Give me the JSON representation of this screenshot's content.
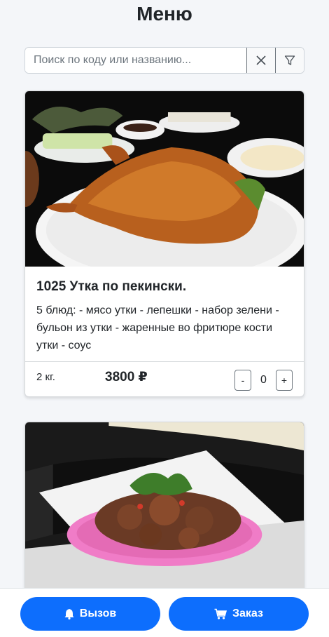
{
  "header": {
    "title": "Меню"
  },
  "search": {
    "placeholder": "Поиск по коду или названию...",
    "value": "",
    "clear_icon": "close-icon",
    "filter_icon": "filter-icon"
  },
  "items": [
    {
      "title": "1025 Утка по пекински.",
      "description": "5 блюд: - мясо утки - лепешки - набор зелени - бульон из утки - жаренные во фритюре кости утки - соус",
      "weight": "2 кг.",
      "price": "3800 ₽",
      "qty_minus": "-",
      "qty_plus": "+",
      "quantity": "0",
      "image": "peking-duck-photo"
    },
    {
      "image": "fried-chicken-plate-photo"
    }
  ],
  "bottom_bar": {
    "call_label": "Вызов",
    "order_label": "Заказ",
    "call_icon": "bell-icon",
    "order_icon": "cart-icon"
  },
  "colors": {
    "primary": "#0d6efd",
    "background": "#f4f6f9"
  }
}
